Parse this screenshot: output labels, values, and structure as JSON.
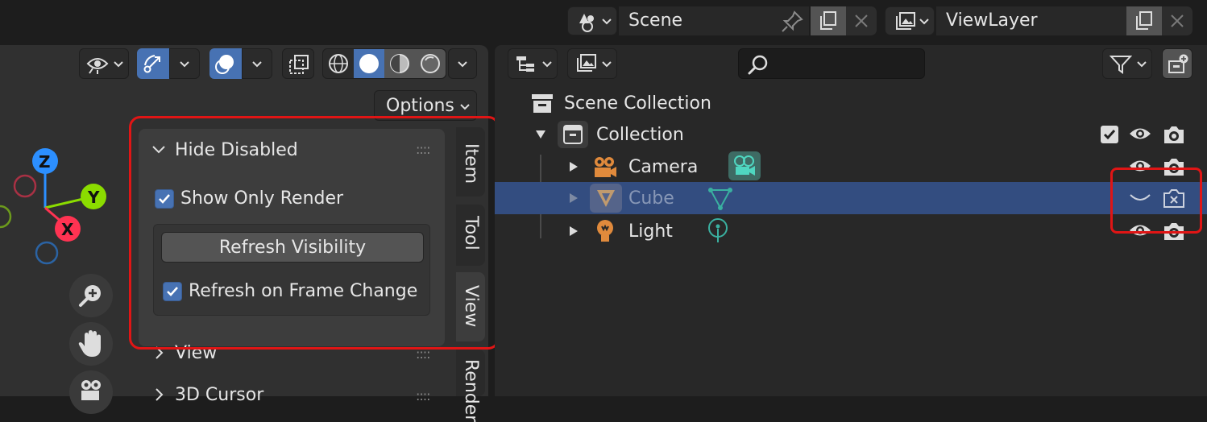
{
  "header": {
    "scene_label": "Scene",
    "viewlayer_label": "ViewLayer"
  },
  "viewport": {
    "options_label": "Options",
    "gizmo": {
      "z": "Z",
      "y": "Y",
      "x": "X"
    }
  },
  "sidebar": {
    "panel_title": "Hide Disabled",
    "show_only_render": "Show Only Render",
    "refresh_visibility": "Refresh Visibility",
    "refresh_on_frame_change": "Refresh on Frame Change",
    "view_panel": "View",
    "cursor_panel": "3D Cursor",
    "tabs": [
      "Item",
      "Tool",
      "View",
      "Render"
    ]
  },
  "outliner": {
    "search_placeholder": "",
    "scene_collection": "Scene Collection",
    "collection": "Collection",
    "objects": [
      {
        "name": "Camera"
      },
      {
        "name": "Cube"
      },
      {
        "name": "Light"
      }
    ]
  },
  "colors": {
    "accent_blue": "#4772b3",
    "selected_row": "#334d80",
    "highlight_red": "#e01515",
    "object_orange": "#e08a3c",
    "data_teal": "#3ab0a0"
  }
}
